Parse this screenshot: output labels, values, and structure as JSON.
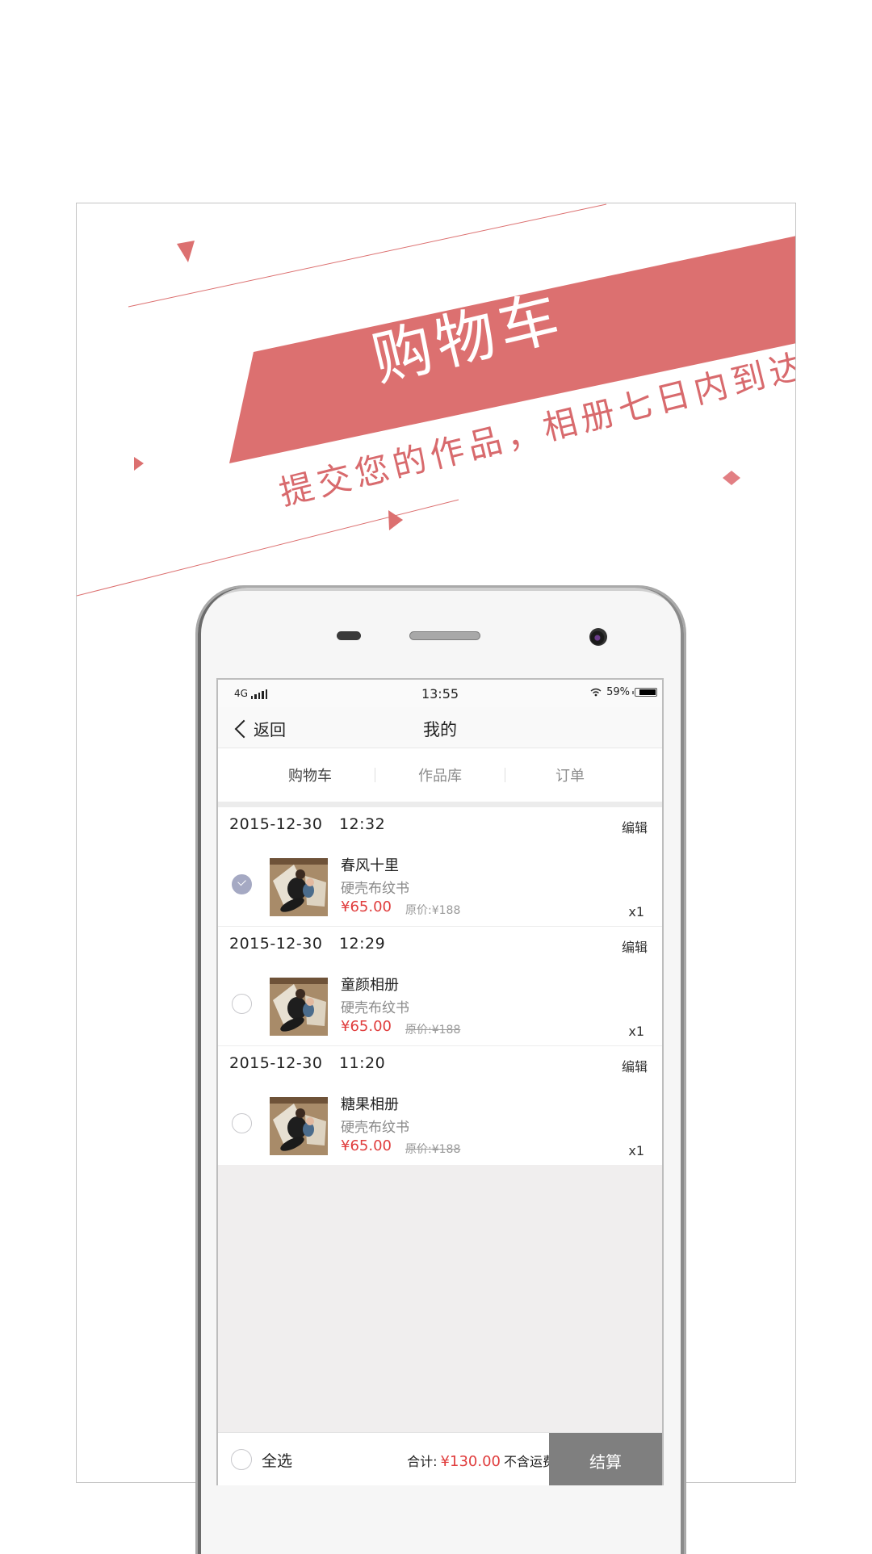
{
  "promo": {
    "title": "购物车",
    "subtitle": "提交您的作品，相册七日内到达",
    "accent_color": "#dc7070"
  },
  "status_bar": {
    "network": "4G",
    "time": "13:55",
    "battery": "59%"
  },
  "nav": {
    "back_label": "返回",
    "title": "我的"
  },
  "tabs": [
    {
      "label": "购物车",
      "active": true
    },
    {
      "label": "作品库",
      "active": false
    },
    {
      "label": "订单",
      "active": false
    }
  ],
  "orders": [
    {
      "date": "2015-12-30 12:32",
      "edit_label": "编辑",
      "checked": true,
      "name": "春风十里",
      "type": "硬壳布纹书",
      "price": "¥65.00",
      "original_price": "原价:¥188",
      "quantity": "x1"
    },
    {
      "date": "2015-12-30 12:29",
      "edit_label": "编辑",
      "checked": false,
      "name": "童颜相册",
      "type": "硬壳布纹书",
      "price": "¥65.00",
      "original_price": "原价:¥188",
      "quantity": "x1"
    },
    {
      "date": "2015-12-30 11:20",
      "edit_label": "编辑",
      "checked": false,
      "name": "糖果相册",
      "type": "硬壳布纹书",
      "price": "¥65.00",
      "original_price": "原价:¥188",
      "quantity": "x1"
    }
  ],
  "footer": {
    "select_all_label": "全选",
    "total_label": "合计:",
    "total_amount": "¥130.00",
    "shipping_note": "不含运费",
    "checkout_label": "结算"
  },
  "colors": {
    "price": "#e03d3d",
    "checked": "#a5a9c3",
    "checkout_bg": "#7f7f7f"
  }
}
